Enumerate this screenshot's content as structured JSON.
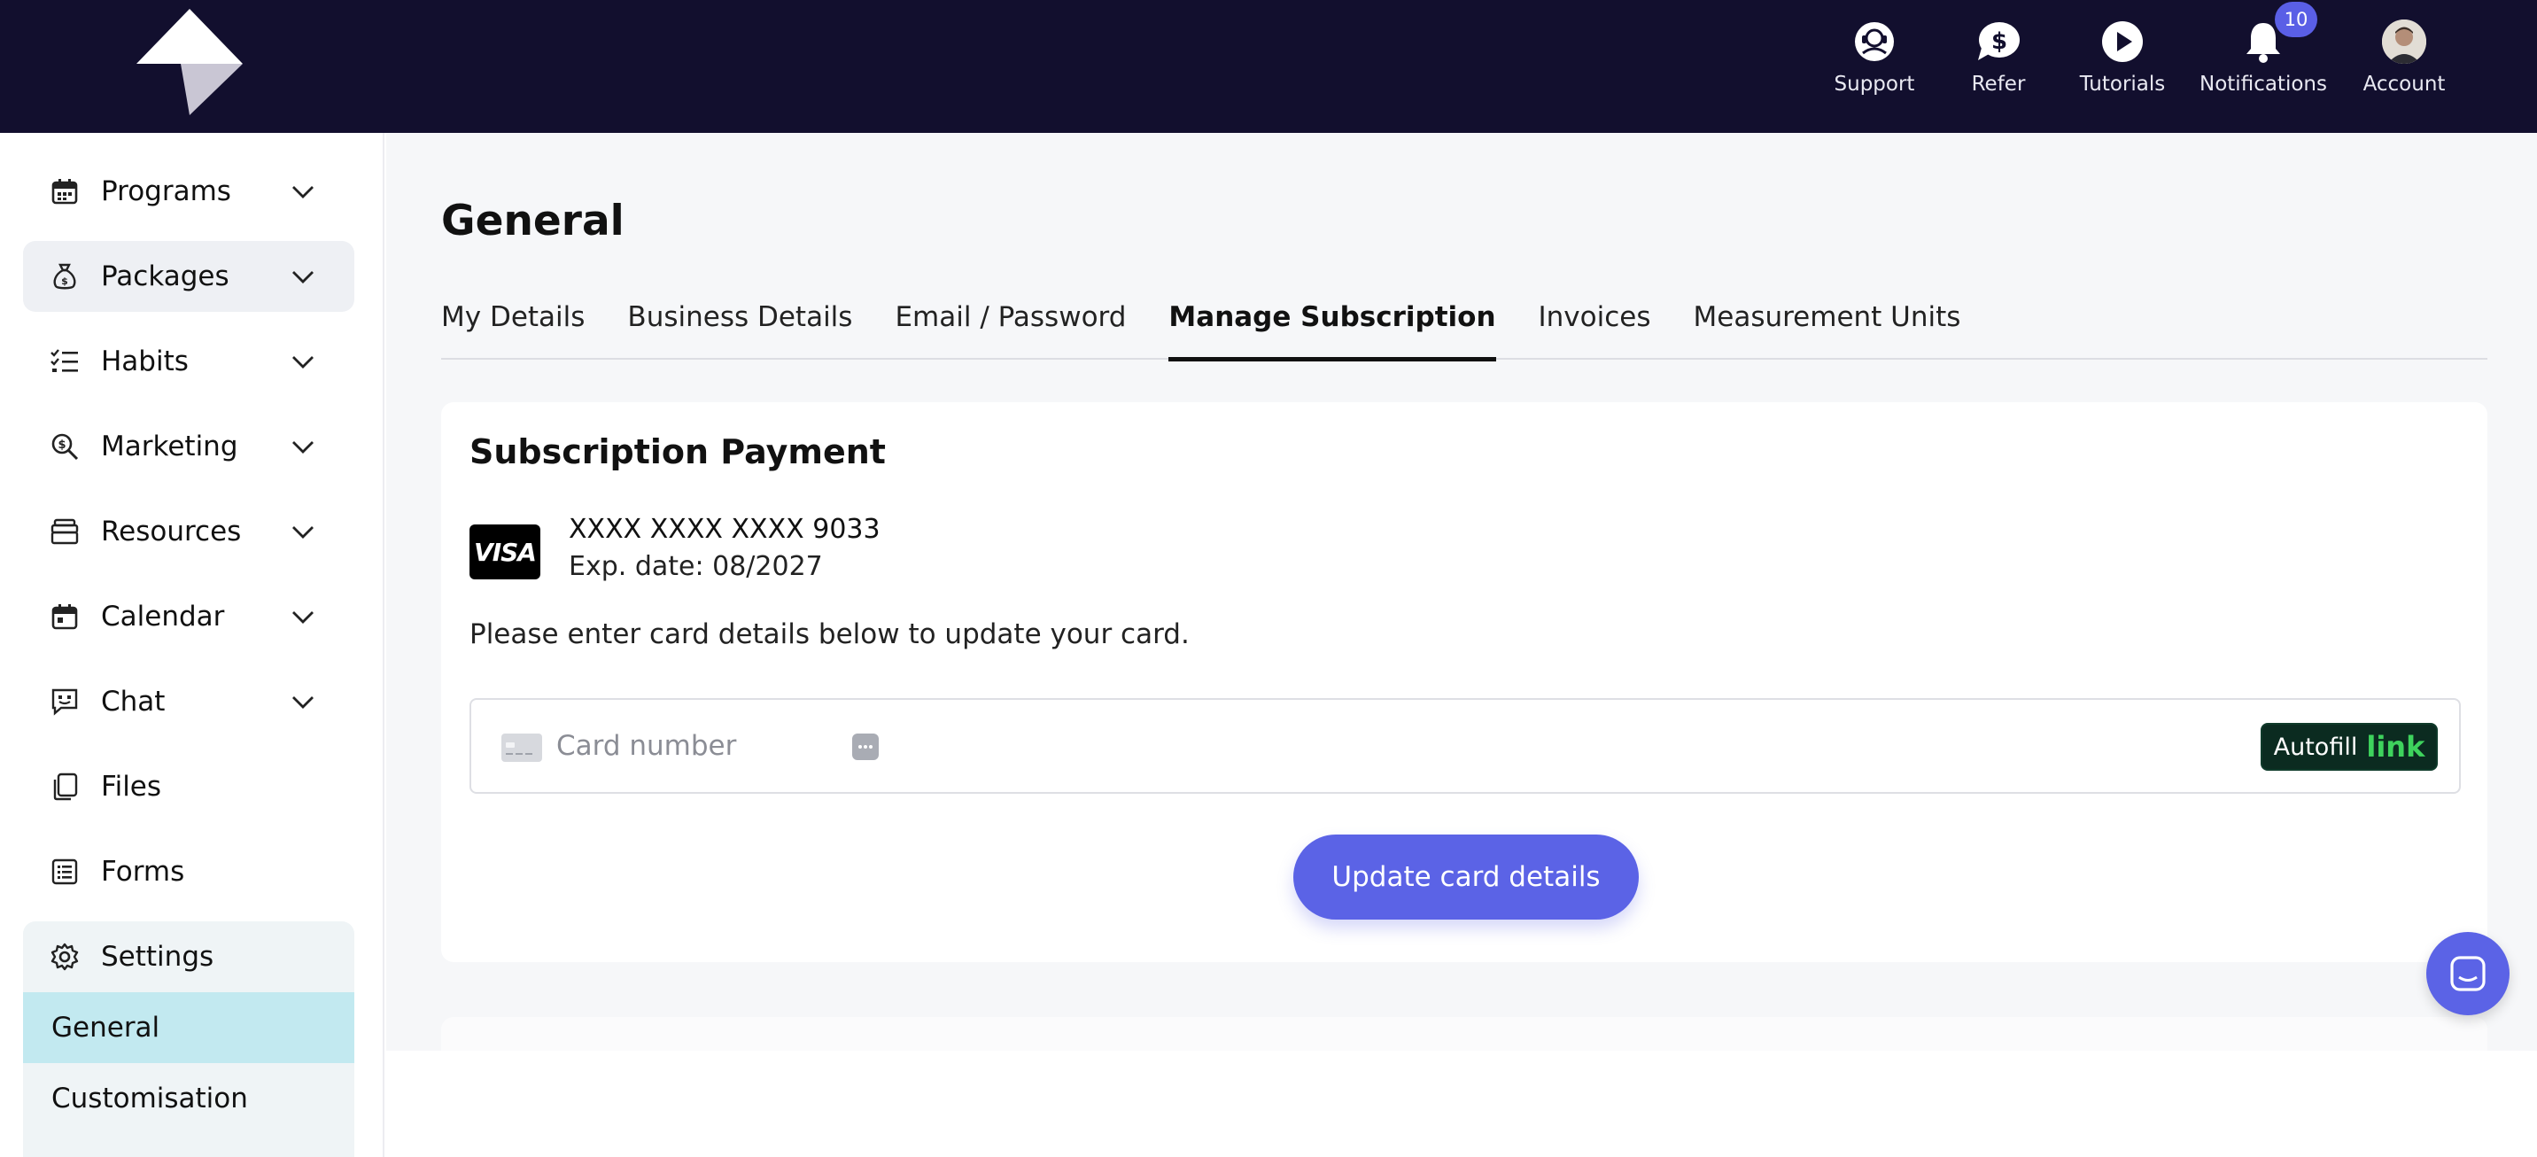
{
  "topnav": {
    "items": [
      {
        "label": "Support",
        "icon": "support-icon"
      },
      {
        "label": "Refer",
        "icon": "dollar-chat-icon"
      },
      {
        "label": "Tutorials",
        "icon": "play-icon"
      },
      {
        "label": "Notifications",
        "icon": "bell-icon",
        "badge": "10"
      },
      {
        "label": "Account",
        "icon": "avatar"
      }
    ]
  },
  "sidebar": {
    "items": [
      {
        "label": "Programs",
        "icon": "calendar-grid-icon"
      },
      {
        "label": "Packages",
        "icon": "moneybag-icon"
      },
      {
        "label": "Habits",
        "icon": "checklist-icon"
      },
      {
        "label": "Marketing",
        "icon": "search-dollar-icon"
      },
      {
        "label": "Resources",
        "icon": "archive-icon"
      },
      {
        "label": "Calendar",
        "icon": "calendar-icon"
      },
      {
        "label": "Chat",
        "icon": "chat-icon"
      },
      {
        "label": "Files",
        "icon": "files-icon"
      },
      {
        "label": "Forms",
        "icon": "form-icon"
      },
      {
        "label": "Settings",
        "icon": "gear-icon"
      }
    ],
    "settings_sub": [
      {
        "label": "General"
      },
      {
        "label": "Customisation"
      }
    ]
  },
  "page": {
    "title": "General",
    "tabs": [
      {
        "label": "My Details"
      },
      {
        "label": "Business Details"
      },
      {
        "label": "Email / Password"
      },
      {
        "label": "Manage Subscription"
      },
      {
        "label": "Invoices"
      },
      {
        "label": "Measurement Units"
      }
    ],
    "active_tab": "Manage Subscription"
  },
  "subscription": {
    "title": "Subscription Payment",
    "card_brand": "VISA",
    "card_number": "XXXX XXXX XXXX 9033",
    "expiry": "Exp. date: 08/2027",
    "note": "Please enter card details below to update your card.",
    "input_placeholder": "Card number",
    "autofill_text": "Autofill",
    "autofill_link": "link",
    "button_label": "Update card details"
  },
  "colors": {
    "topbar": "#120f2e",
    "accent": "#5b63e6",
    "active_sub": "#c2e9f0",
    "link_green": "#3ed35d"
  }
}
